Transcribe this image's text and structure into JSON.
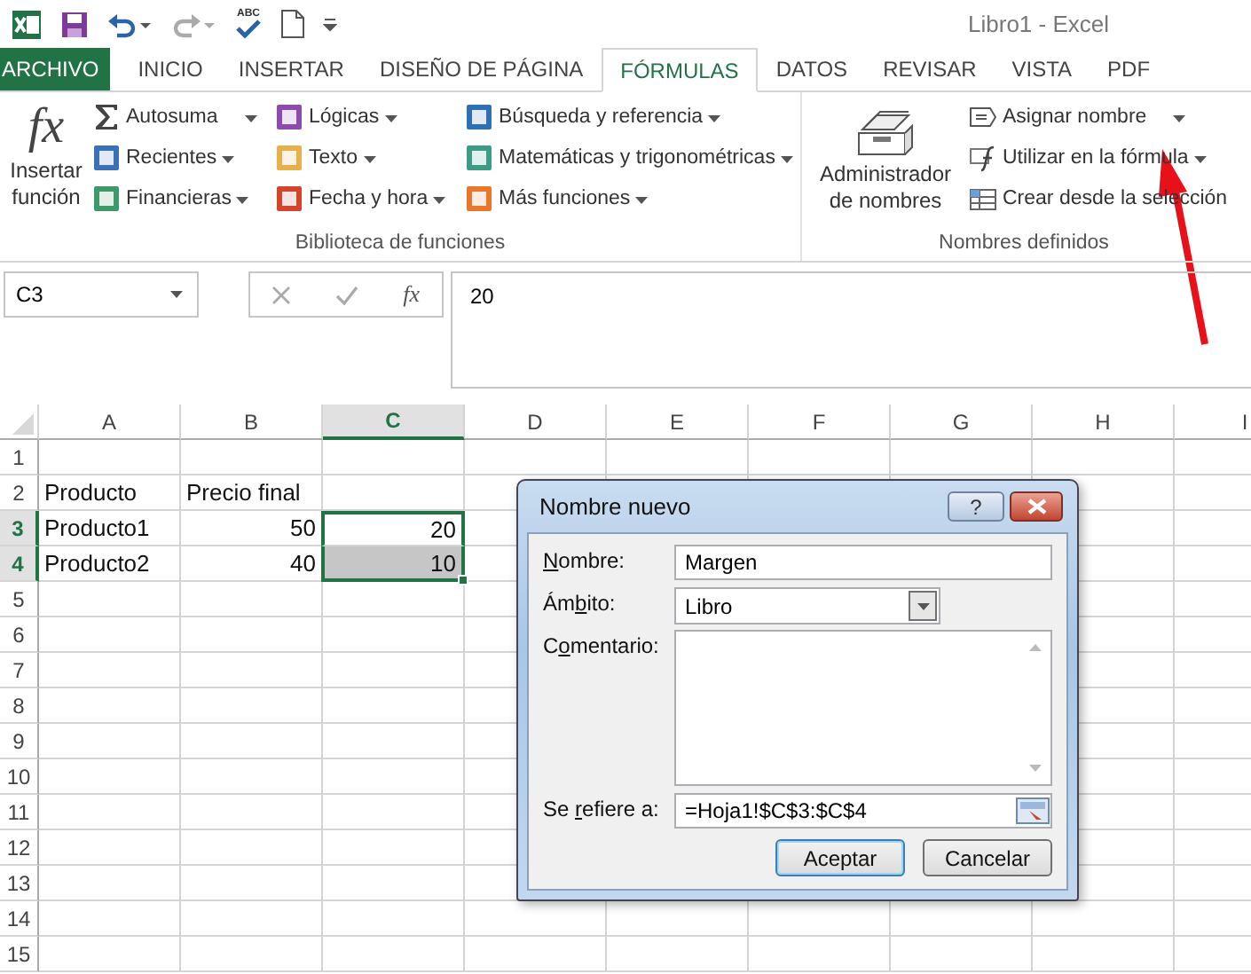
{
  "window": {
    "title": "Libro1 - Excel",
    "spell_glyph": "ABC"
  },
  "tabs": [
    {
      "label": "ARCHIVO",
      "kind": "file",
      "selected": false
    },
    {
      "label": "INICIO",
      "kind": "tab",
      "selected": false
    },
    {
      "label": "INSERTAR",
      "kind": "tab",
      "selected": false
    },
    {
      "label": "DISEÑO DE PÁGINA",
      "kind": "tab",
      "selected": false
    },
    {
      "label": "FÓRMULAS",
      "kind": "tab",
      "selected": true
    },
    {
      "label": "DATOS",
      "kind": "tab",
      "selected": false
    },
    {
      "label": "REVISAR",
      "kind": "tab",
      "selected": false
    },
    {
      "label": "VISTA",
      "kind": "tab",
      "selected": false
    },
    {
      "label": "PDF",
      "kind": "tab",
      "selected": false
    }
  ],
  "ribbon": {
    "groups": [
      {
        "label": "Biblioteca de funciones",
        "large": {
          "kind": "fx",
          "glyph": "fx",
          "label": "Insertar función"
        },
        "columns": [
          [
            {
              "label": "Autosuma",
              "kind": "sigma",
              "dropdown": true
            },
            {
              "label": "Recientes",
              "kind": "book",
              "color": "#3b6fb6",
              "dropdown": true
            },
            {
              "label": "Financieras",
              "kind": "book",
              "color": "#3f9a6b",
              "dropdown": true
            }
          ],
          [
            {
              "label": "Lógicas",
              "kind": "book",
              "color": "#8d4bb0",
              "dropdown": true
            },
            {
              "label": "Texto",
              "kind": "book",
              "color": "#e8b04a",
              "dropdown": true
            },
            {
              "label": "Fecha y hora",
              "kind": "book",
              "color": "#d2452c",
              "dropdown": true
            }
          ],
          [
            {
              "label": "Búsqueda y referencia",
              "kind": "book",
              "color": "#2f6fb5",
              "dropdown": true
            },
            {
              "label": "Matemáticas y trigonométricas",
              "kind": "book",
              "color": "#3c9c86",
              "dropdown": true
            },
            {
              "label": "Más funciones",
              "kind": "book",
              "color": "#e8772a",
              "dropdown": true
            }
          ]
        ]
      },
      {
        "label": "Nombres definidos",
        "large": {
          "kind": "cards",
          "label": "Administrador de nombres"
        },
        "columns": [
          [
            {
              "label": "Asignar nombre",
              "kind": "tag",
              "dropdown": true
            },
            {
              "label": "Utilizar en la fórmula",
              "kind": "fx",
              "dropdown": true
            },
            {
              "label": "Crear desde la selección",
              "kind": "table",
              "dropdown": false
            }
          ]
        ]
      }
    ]
  },
  "formula_bar": {
    "name_box": "C3",
    "function_glyph": "fx",
    "value": "20"
  },
  "sheet": {
    "columns": [
      {
        "label": "A",
        "selected": false
      },
      {
        "label": "B",
        "selected": false
      },
      {
        "label": "C",
        "selected": true
      },
      {
        "label": "D",
        "selected": false
      },
      {
        "label": "E",
        "selected": false
      },
      {
        "label": "F",
        "selected": false
      },
      {
        "label": "G",
        "selected": false
      },
      {
        "label": "H",
        "selected": false
      },
      {
        "label": "I",
        "selected": false
      }
    ],
    "rows": [
      {
        "label": "1",
        "selected": false
      },
      {
        "label": "2",
        "selected": false,
        "cells": [
          {
            "text": "Producto",
            "kind": "text",
            "selected": false
          },
          {
            "text": "Precio final",
            "kind": "text",
            "selected": false
          }
        ]
      },
      {
        "label": "3",
        "selected": true,
        "cells": [
          {
            "text": "Producto1",
            "kind": "text",
            "selected": false
          },
          {
            "text": "50",
            "kind": "number",
            "selected": false
          },
          {
            "text": "20",
            "kind": "number",
            "selected": true,
            "active": true
          }
        ]
      },
      {
        "label": "4",
        "selected": true,
        "cells": [
          {
            "text": "Producto2",
            "kind": "text",
            "selected": false
          },
          {
            "text": "40",
            "kind": "number",
            "selected": false
          },
          {
            "text": "10",
            "kind": "number",
            "selected": true,
            "active": false
          }
        ]
      },
      {
        "label": "5",
        "selected": false
      },
      {
        "label": "6",
        "selected": false
      },
      {
        "label": "7",
        "selected": false
      },
      {
        "label": "8",
        "selected": false
      },
      {
        "label": "9",
        "selected": false
      },
      {
        "label": "10",
        "selected": false
      },
      {
        "label": "11",
        "selected": false
      },
      {
        "label": "12",
        "selected": false
      },
      {
        "label": "13",
        "selected": false
      },
      {
        "label": "14",
        "selected": false
      },
      {
        "label": "15",
        "selected": false
      }
    ]
  },
  "dialog": {
    "title": "Nombre nuevo",
    "help": "?",
    "fields": [
      {
        "kind": "text",
        "label": {
          "key": "N",
          "after": "ombre:"
        },
        "value": "Margen"
      },
      {
        "kind": "select",
        "label": {
          "before": "Ám",
          "key": "b",
          "after": "ito:"
        },
        "value": "Libro"
      },
      {
        "kind": "textarea",
        "label": {
          "before": "C",
          "key": "o",
          "after": "mentario:"
        }
      },
      {
        "kind": "reference",
        "label": {
          "before": "Se ",
          "key": "r",
          "after": "efiere a:"
        },
        "value": "=Hoja1!$C$3:$C$4"
      }
    ],
    "buttons": [
      {
        "label": "Aceptar",
        "default": true
      },
      {
        "label": "Cancelar",
        "default": false
      }
    ]
  }
}
